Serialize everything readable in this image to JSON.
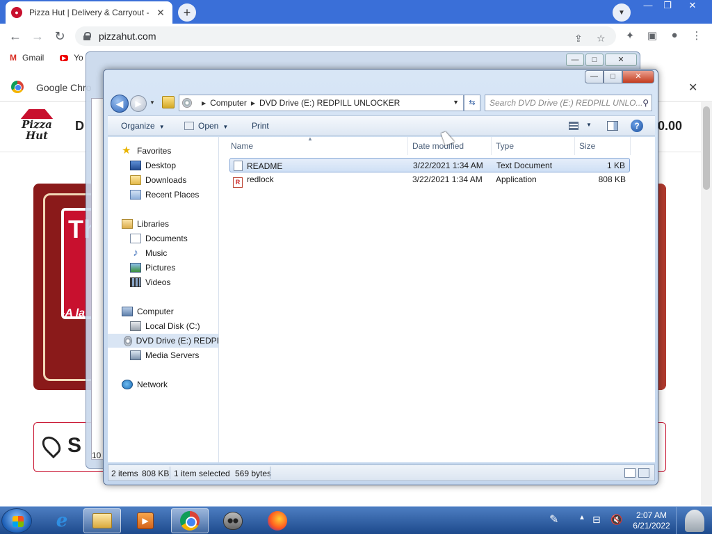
{
  "browser": {
    "tab_title": "Pizza Hut | Delivery & Carryout -",
    "url": "pizzahut.com",
    "bookmarks": [
      {
        "label": "Gmail",
        "icon": "gmail-icon"
      },
      {
        "label": "Yo",
        "icon": "youtube-icon"
      }
    ],
    "infobar_text": "Google Chro"
  },
  "page": {
    "header_text": "D",
    "cart_text": "0.00",
    "banner_letter": "Th",
    "banner_tag": "-A la",
    "store_text": "S"
  },
  "background_window": {
    "number": "10"
  },
  "explorer": {
    "address": {
      "crumbs": [
        "Computer",
        "DVD Drive (E:) REDPILL UNLOCKER"
      ]
    },
    "search_placeholder": "Search DVD Drive (E:) REDPILL UNLO...",
    "toolbar": {
      "organize": "Organize",
      "open": "Open",
      "print": "Print"
    },
    "nav": {
      "favorites": "Favorites",
      "desktop": "Desktop",
      "downloads": "Downloads",
      "recent_places": "Recent Places",
      "libraries": "Libraries",
      "documents": "Documents",
      "music": "Music",
      "pictures": "Pictures",
      "videos": "Videos",
      "computer": "Computer",
      "local_disk": "Local Disk (C:)",
      "dvd_drive": "DVD Drive (E:) REDPI",
      "media_servers": "Media Servers",
      "network": "Network"
    },
    "columns": {
      "name": "Name",
      "date": "Date modified",
      "type": "Type",
      "size": "Size"
    },
    "files": [
      {
        "name": "README",
        "date": "3/22/2021 1:34 AM",
        "type": "Text Document",
        "size": "1 KB",
        "selected": true
      },
      {
        "name": "redlock",
        "date": "3/22/2021 1:34 AM",
        "type": "Application",
        "size": "808 KB",
        "selected": false
      }
    ],
    "status": {
      "items": "2 items",
      "total_size": "808 KB",
      "selected": "1 item selected",
      "bytes": "569 bytes"
    }
  },
  "taskbar": {
    "time": "2:07 AM",
    "date": "6/21/2022"
  },
  "colors": {
    "chrome_tabbar": "#3a6fd8",
    "pizzahut_red": "#c8102e",
    "taskbar": "#1d4a8c",
    "selection": "#cfe0f5"
  }
}
